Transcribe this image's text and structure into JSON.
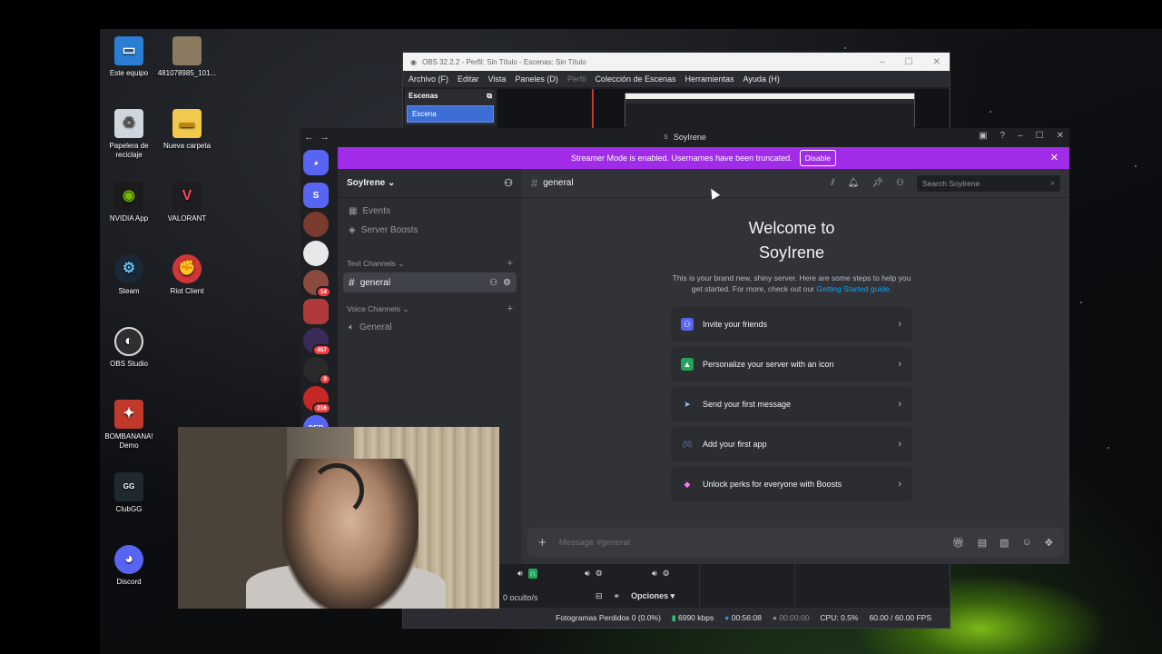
{
  "desktop": {
    "icons": [
      {
        "label": "Este equipo",
        "icon": "computer-icon"
      },
      {
        "label": "481078985_101...",
        "icon": "image-file-icon"
      },
      {
        "label": "Papelera de reciclaje",
        "icon": "recycle-bin-icon"
      },
      {
        "label": "Nueva carpeta",
        "icon": "folder-icon"
      },
      {
        "label": "NVIDIA App",
        "icon": "nvidia-icon"
      },
      {
        "label": "VALORANT",
        "icon": "valorant-icon"
      },
      {
        "label": "Steam",
        "icon": "steam-icon"
      },
      {
        "label": "Riot Client",
        "icon": "riot-icon"
      },
      {
        "label": "OBS Studio",
        "icon": "obs-icon"
      },
      {
        "label": "BOMBANANA! Demo",
        "icon": "game-icon"
      },
      {
        "label": "ClubGG",
        "icon": "clubgg-icon"
      },
      {
        "label": "Discord",
        "icon": "discord-icon"
      }
    ]
  },
  "obs": {
    "title": "OBS 32.2.2 - Perfil: Sin Título - Escenas: Sin Título",
    "menu": [
      "Archivo (F)",
      "Editar",
      "Vista",
      "Paneles (D)",
      "Perfil",
      "Colección de Escenas",
      "Herramientas",
      "Ayuda (H)"
    ],
    "scenes_header": "Escenas",
    "scene_selected": "Escena",
    "hidden_count": "0 oculto/s",
    "options_label": "Opciones",
    "status": {
      "dropped_frames": "Fotogramas Perdidos 0 (0.0%)",
      "bitrate": "6990 kbps",
      "stream_time": "00:56:08",
      "rec_time": "00:00:00",
      "cpu": "CPU: 0.5%",
      "fps": "60.00 / 60.00 FPS"
    }
  },
  "discord": {
    "window_title": "SoyIrene",
    "banner": {
      "text": "Streamer Mode is enabled. Usernames have been truncated.",
      "button": "Disable"
    },
    "servers": [
      {
        "label": "S",
        "badge": ""
      },
      {
        "label": "",
        "badge": ""
      },
      {
        "label": "",
        "badge": ""
      },
      {
        "label": "",
        "badge": "14"
      },
      {
        "label": "",
        "badge": ""
      },
      {
        "label": "",
        "badge": "457"
      },
      {
        "label": "",
        "badge": "9"
      },
      {
        "label": "",
        "badge": "216"
      },
      {
        "label": "DEB",
        "badge": ""
      }
    ],
    "server_name": "SoyIrene",
    "sidebar": {
      "events": "Events",
      "boosts": "Server Boosts",
      "text_category": "Text Channels",
      "text_channel": "general",
      "voice_category": "Voice Channels",
      "voice_channel": "General"
    },
    "header": {
      "channel": "general",
      "search_placeholder": "Search SoyIrene"
    },
    "welcome": {
      "title_line1": "Welcome to",
      "title_line2": "SoyIrene",
      "desc": "This is your brand new, shiny server. Here are some steps to help you get started. For more, check out our",
      "link": "Getting Started guide."
    },
    "cards": [
      {
        "label": "Invite your friends",
        "icon": "invite-icon",
        "color": "#5865f2"
      },
      {
        "label": "Personalize your server with an icon",
        "icon": "palette-icon",
        "color": "#23a55a"
      },
      {
        "label": "Send your first message",
        "icon": "send-icon",
        "color": "#a0c4ff"
      },
      {
        "label": "Add your first app",
        "icon": "gamepad-icon",
        "color": "#7289da"
      },
      {
        "label": "Unlock perks for everyone with Boosts",
        "icon": "boost-icon",
        "color": "#ff73fa"
      }
    ],
    "composer_placeholder": "Message #general"
  }
}
